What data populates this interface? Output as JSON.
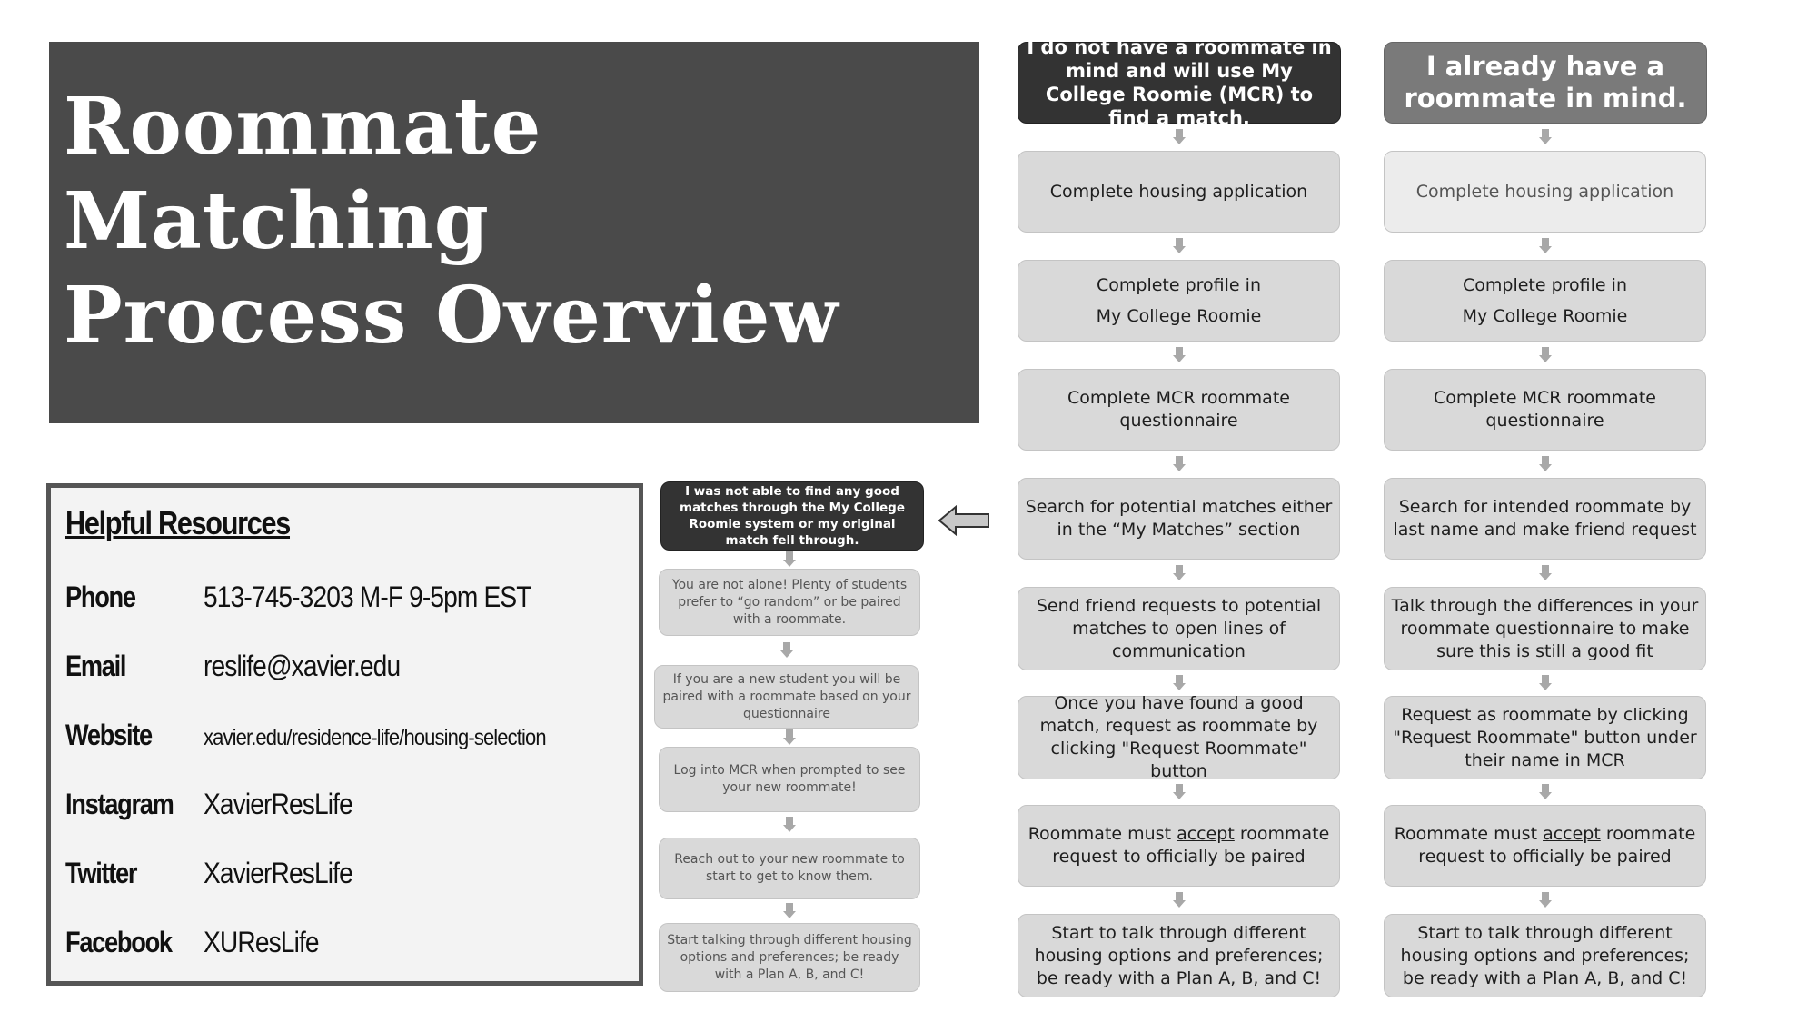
{
  "title": {
    "line1": "Roommate Matching",
    "line2": "Process Overview"
  },
  "resources": {
    "heading": "Helpful Resources",
    "rows": [
      {
        "label": "Phone",
        "value": "513-745-3203  M-F 9-5pm EST"
      },
      {
        "label": "Email",
        "value": "reslife@xavier.edu"
      },
      {
        "label": "Website",
        "value": "xavier.edu/residence-life/housing-selection"
      },
      {
        "label": "Instagram",
        "value": "XavierResLife"
      },
      {
        "label": "Twitter",
        "value": "XavierResLife"
      },
      {
        "label": "Facebook",
        "value": "XUResLife"
      }
    ]
  },
  "flow_mcr": {
    "header": "I do not have a roommate in mind and will use My College Roomie (MCR) to find a match.",
    "steps": [
      {
        "text": "Complete housing application"
      },
      {
        "text": "Complete profile in\nMy College Roomie"
      },
      {
        "text": "Complete MCR roommate questionnaire"
      },
      {
        "text": "Search for potential matches either in the “My Matches” section"
      },
      {
        "text": "Send friend requests to potential matches to open lines of communication"
      },
      {
        "text": "Once you have found a good match, request as roommate by clicking \"Request Roommate\" button"
      },
      {
        "pre": "Roommate must ",
        "u": "accept",
        "post": " roommate request to officially be paired"
      },
      {
        "text": "Start to talk through different housing options and preferences; be ready with a Plan A, B, and C!"
      }
    ]
  },
  "flow_known": {
    "header": "I already have a roommate in mind.",
    "steps": [
      {
        "text": "Complete housing application"
      },
      {
        "text": "Complete profile in\nMy College Roomie"
      },
      {
        "text": "Complete MCR roommate questionnaire"
      },
      {
        "text": "Search for intended roommate by last name and make friend request"
      },
      {
        "text": "Talk through the differences in your roommate questionnaire to make sure this is still a good fit"
      },
      {
        "text": "Request as roommate by clicking \"Request Roommate\" button under their name in MCR"
      },
      {
        "pre": "Roommate must ",
        "u": "accept",
        "post": " roommate request to officially be paired"
      },
      {
        "text": "Start to talk through different housing options and preferences; be ready with a Plan A, B, and C!"
      }
    ]
  },
  "flow_fallback": {
    "header": "I was not able to find any good matches through the My College Roomie system or my original match fell through.",
    "steps": [
      {
        "text": "You are not alone! Plenty of students prefer to “go random” or be paired with a roommate."
      },
      {
        "text": "If you are a new student you will be paired with a roommate based on your questionnaire"
      },
      {
        "text": "Log into MCR when prompted to see your new roommate!"
      },
      {
        "text": "Reach out to your new roommate to start to get to know them."
      },
      {
        "text": "Start talking through different housing options and preferences; be ready with a Plan A, B, and C!"
      }
    ]
  },
  "icons": {
    "flow_arrow": "down-arrow",
    "fallback_link_arrow": "left-arrow"
  }
}
